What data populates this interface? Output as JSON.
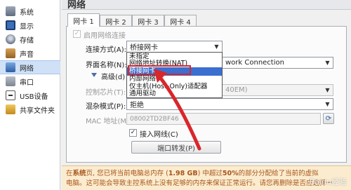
{
  "header": {
    "title": "网络"
  },
  "sidebar": {
    "items": [
      {
        "label": "系统",
        "icon": "system-icon"
      },
      {
        "label": "显示",
        "icon": "display-icon"
      },
      {
        "label": "存储",
        "icon": "storage-icon"
      },
      {
        "label": "声音",
        "icon": "audio-icon"
      },
      {
        "label": "网络",
        "icon": "network-icon",
        "selected": true
      },
      {
        "label": "串口",
        "icon": "serial-port-icon"
      },
      {
        "label": "USB设备",
        "icon": "usb-icon"
      },
      {
        "label": "共享文件夹",
        "icon": "shared-folder-icon"
      }
    ]
  },
  "tabs": [
    {
      "label": "网卡 1",
      "active": true
    },
    {
      "label": "网卡 2"
    },
    {
      "label": "网卡 3"
    },
    {
      "label": "网卡 4"
    }
  ],
  "adapter": {
    "enable_label": "启用网络连接",
    "attached_label": "连接方式(A):",
    "attached_value": "桥接网卡",
    "name_label": "界面名称(N):",
    "name_value": "work Connection",
    "advanced_label": "高级(d)",
    "adapter_type_label": "控制芯片(T):",
    "adapter_type_value": "40EM)",
    "promisc_label": "混杂模式(P):",
    "promisc_value": "拒绝",
    "mac_label": "MAC 地址(M):",
    "mac_value": "08002TD2BF46",
    "cable_label": "接入网线(C)",
    "port_forward_label": "端口转发(P)"
  },
  "dropdown": {
    "options": [
      "未指定",
      "网络地址转换(NAT)",
      "桥接网卡",
      "内部网络",
      "仅主机(Host-Only)适配器",
      "通用驱动"
    ],
    "highlighted_index": 2
  },
  "warning": {
    "line1_prefix": "在",
    "line1_bold": "系统",
    "line1_mid": "页, 您已将当前电脑总内存 (",
    "line1_mem": "1.98 GB",
    "line1_mid2": ") 中超过",
    "line1_pct": "50%",
    "line1_end": "的部分分配给了当前的虚拟",
    "line2": "电脑。这可能会导致主控系统上没有足够的内存来保证正常运行。请您再删除是否应选择一"
  },
  "watermark": "Baidu经验",
  "colors": {
    "annotation": "#d9262b",
    "selection": "#3b6fd0",
    "warning_text": "#a8551a"
  }
}
